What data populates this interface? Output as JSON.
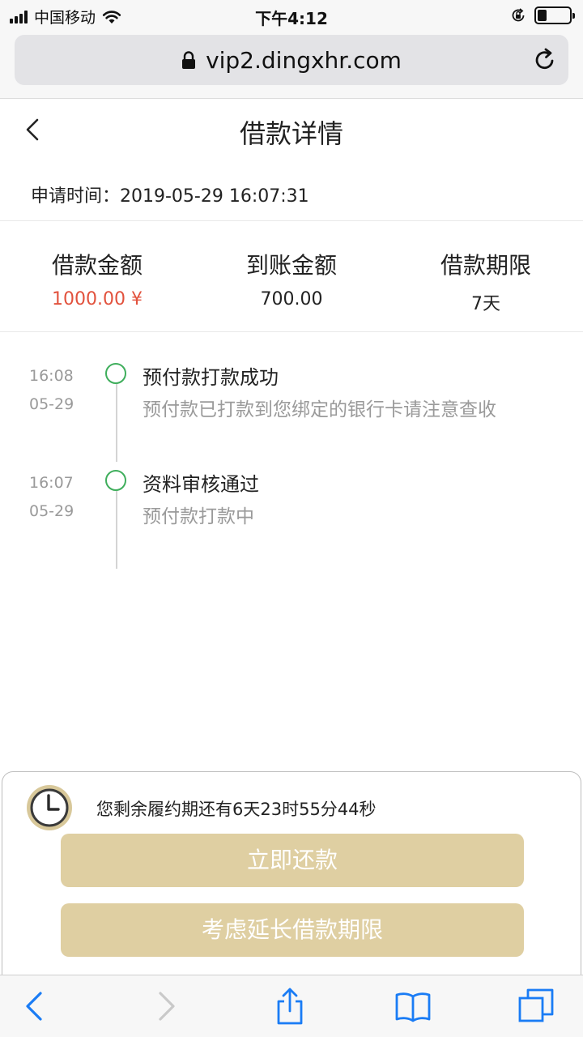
{
  "status_bar": {
    "carrier": "中国移动",
    "time": "下午4:12",
    "battery_level": 0.3
  },
  "browser": {
    "url": "vip2.dingxhr.com"
  },
  "page": {
    "title": "借款详情",
    "apply_time": "申请时间：2019-05-29 16:07:31"
  },
  "summary": [
    {
      "label": "借款金额",
      "value": "1000.00 ¥",
      "color": "#e2523d"
    },
    {
      "label": "到账金额",
      "value": "700.00"
    },
    {
      "label": "借款期限",
      "value": "7天"
    }
  ],
  "timeline": [
    {
      "time": "16:08",
      "date": "05-29",
      "title": "预付款打款成功",
      "desc": "预付款已打款到您绑定的银行卡请注意查收"
    },
    {
      "time": "16:07",
      "date": "05-29",
      "title": "资料审核通过",
      "desc": "预付款打款中"
    }
  ],
  "bottom": {
    "countdown": "您剩余履约期还有6天23时55分44秒",
    "repay_button": "立即还款",
    "extend_button": "考虑延长借款期限"
  },
  "colors": {
    "accent_gold": "#dfcfa2",
    "success_green": "#3fae5c",
    "ios_blue": "#1a7cf5",
    "amount_red": "#e2523d"
  },
  "icons": {
    "back": "chevron-left-icon",
    "reload": "reload-icon",
    "padlock": "padlock-icon",
    "clock": "clock-icon",
    "share": "share-icon",
    "bookmarks": "book-icon",
    "tabs": "tabs-icon"
  }
}
